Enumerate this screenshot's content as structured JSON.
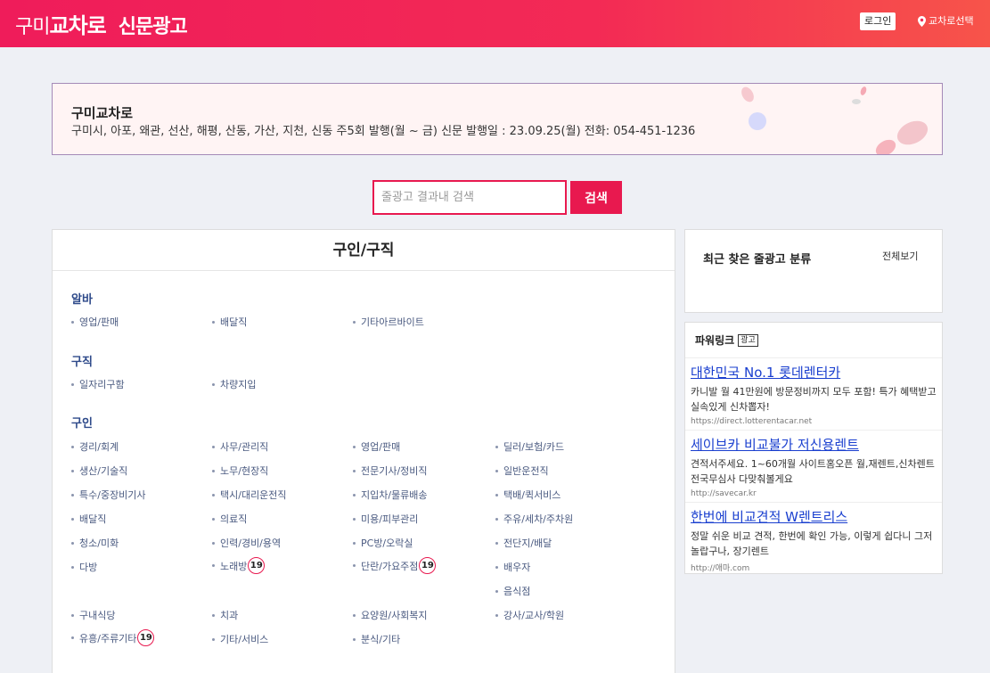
{
  "header": {
    "logo_part1": "구미",
    "logo_part2": "교차로",
    "logo_part3": "신문광고",
    "login_label": "로그인",
    "region_label": "교차로선택"
  },
  "banner": {
    "title": "구미교차로",
    "description": "구미시, 아포, 왜관, 선산, 해평, 산동, 가산, 지천, 신동 주5회 발행(월 ~ 금) 신문 발행일 : 23.09.25(월) 전화: 054-451-1236"
  },
  "search": {
    "placeholder": "줄광고 결과내 검색",
    "button_label": "검색"
  },
  "main": {
    "title": "구인/구직",
    "sections": [
      {
        "heading": "알바",
        "items": [
          "영업/판매",
          "배달직",
          "기타아르바이트"
        ]
      },
      {
        "heading": "구직",
        "items": [
          "일자리구함",
          "차량지입"
        ]
      },
      {
        "heading": "구인",
        "items": [
          "경리/회계",
          "사무/관리직",
          "영업/판매",
          "딜러/보험/카드",
          "생산/기술직",
          "노무/현장직",
          "전문기사/정비직",
          "일반운전직",
          "특수/중장비기사",
          "택시/대리운전직",
          "지입차/물류배송",
          "택배/퀵서비스",
          "배달직",
          "의료직",
          "미용/피부관리",
          "주유/세차/주차원",
          "청소/미화",
          "인력/경비/용역",
          "PC방/오락실",
          "전단지/배달",
          "다방",
          "노래방",
          "단란/가요주점",
          "배우자",
          "음식점",
          "구내식당",
          "치과",
          "요양원/사회복지",
          "강사/교사/학원",
          "유흥/주류기타",
          "기타/서비스",
          "분식/기타"
        ]
      }
    ],
    "age_badge": "19"
  },
  "recent": {
    "title": "최근 찾은 줄광고 분류",
    "view_all": "전체보기"
  },
  "powerlink": {
    "title": "파워링크",
    "tag": "광고",
    "ads": [
      {
        "title": "대한민국 No.1 롯데렌터카",
        "desc": "카니발 월 41만원에 방문정비까지 모두 포함! 특가 혜택받고 실속있게 신차뽑자!",
        "url": "https://direct.lotterentacar.net"
      },
      {
        "title": "세이브카 비교불가 저신용렌트",
        "desc": "견적서주세요. 1~60개월 사이트홈오픈 월,재렌트,신차렌트 전국무심사 다맞춰볼게요",
        "url": "http://savecar.kr"
      },
      {
        "title": "한번에 비교견적 W렌트리스",
        "desc": "정말 쉬운 비교 견적, 한번에 확인 가능, 이렇게 쉽다니 그저 놀랍구나, 장기렌트",
        "url": "http://애마.com"
      }
    ]
  },
  "colors": {
    "brand": "#e8194f",
    "link": "#1a3fcf",
    "category_heading": "#2e4a8a"
  }
}
